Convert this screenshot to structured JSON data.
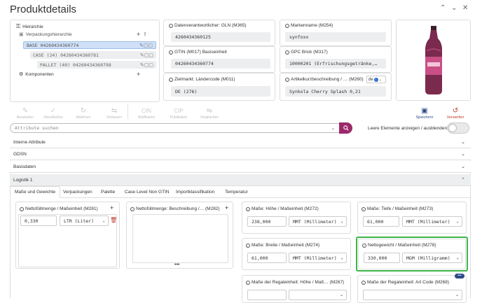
{
  "page": {
    "title": "Produktdetails"
  },
  "window": {
    "collapse_icon": "⌃",
    "expand_icon": "⌄",
    "close_icon": "✕"
  },
  "hierarchy": {
    "header": "Hierarchie",
    "sub_header": "Verpackungshierarchie",
    "rows": [
      {
        "label": "BASE 04260434360774"
      },
      {
        "label": "CASE (24) 04260434360781"
      },
      {
        "label": "PALLET (40) 04260434360798"
      }
    ],
    "components": "Komponenten"
  },
  "fields": {
    "gln_label": "Datenverantwortlicher: GLN (M365)",
    "gln_value": "4260434360125",
    "brand_label": "Markenname (M254)",
    "brand_value": "synfoxx",
    "gtin_label": "GTIN (M017) Basiseinheit",
    "gtin_value": "04260434360774",
    "gpc_label": "GPC Brick (M317)",
    "gpc_value": "10000201 (Erfrischungsgetränke,…",
    "target_label": "Zielmarkt: Ländercode (M011)",
    "target_value": "DE (276)",
    "desc_label": "Artikelkurzbeschreibung / … (M260)",
    "desc_value": "Synkola Cherry Splash 0,21",
    "desc_lang": "de"
  },
  "toolbar": {
    "items": [
      "Bearbeiten",
      "Abschließen",
      "Ablehnen",
      "Verlassen",
      "Notifikation",
      "Publikation",
      "Vergleichen"
    ],
    "item_icons": [
      "✎",
      "✓",
      "↻",
      "⇆",
      "CIN",
      "CIP",
      "⇋"
    ],
    "save": "Speichern",
    "discard": "Verwerfen"
  },
  "search": {
    "placeholder": "Attribute suchen"
  },
  "toggle_label": "Leere Elemente anzeigen / ausblenden",
  "sections": [
    "Interne Attribute",
    "GDSN",
    "Basisdaten",
    "Logistik 1"
  ],
  "tabs": [
    "Maße und Gewichte",
    "Verpackungen",
    "Palette",
    "Case Level Non GTIN",
    "Importklassifikation",
    "Temperatur"
  ],
  "net_fill": {
    "label": "Nettofüllmenge / Maßeinheit (M281)",
    "value": "0,330",
    "unit": "LTR (Liter)"
  },
  "net_fill_desc": {
    "label": "Nettofüllmenge: Beschreibung /… (M282)",
    "more": "•••"
  },
  "height": {
    "label": "Maße: Höhe / Maßeinheit (M272)",
    "value": "238,000",
    "unit": "MMT (Millimeter)"
  },
  "depth": {
    "label": "Maße: Tiefe / Maßeinheit (M273)",
    "value": "61,000",
    "unit": "MMT (Millimeter)"
  },
  "width": {
    "label": "Maße: Breite / Maßeinheit (M274)",
    "value": "61,000",
    "unit": "MMT (Millimeter)"
  },
  "net_weight": {
    "label": "Nettogewicht / Maßeinheit (M278)",
    "value": "330,000",
    "unit": "MGM (Milligramm)"
  },
  "shelf_height": {
    "label": "Maße der Regaleinheit: Höhe / Maß… (M267)"
  },
  "shelf_type": {
    "label": "Maße der Regaleinheit: Art Code (M268)",
    "more": "•••"
  },
  "colors": {
    "accent": "#9c2a6b",
    "highlight": "#3cb54a",
    "tree_selected": "#cfe0f7",
    "discard": "#c0392b",
    "save": "#2d4a86"
  }
}
